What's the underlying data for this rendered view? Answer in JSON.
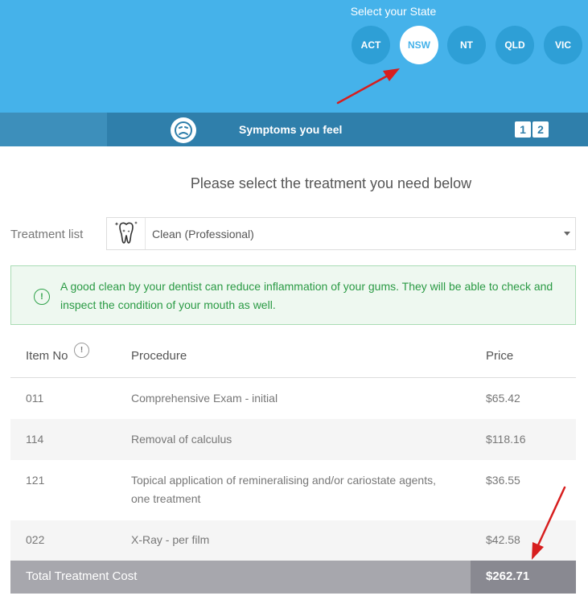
{
  "state_selector": {
    "title": "Select your State",
    "states": [
      "ACT",
      "NSW",
      "NT",
      "QLD",
      "VIC"
    ],
    "selected": "NSW"
  },
  "step": {
    "label": "Symptoms you feel",
    "numbers": [
      "1",
      "2"
    ]
  },
  "heading": "Please select the treatment you need below",
  "treatment_list": {
    "label": "Treatment list",
    "selected_value": "Clean (Professional)"
  },
  "info": {
    "icon": "!",
    "text": "A good clean by your dentist can reduce inflammation of your gums. They will be able to check and inspect the condition of your mouth as well."
  },
  "table": {
    "headers": {
      "item_no": "Item No",
      "procedure": "Procedure",
      "price": "Price",
      "help_icon": "!"
    },
    "rows": [
      {
        "item": "011",
        "procedure": "Comprehensive Exam - initial",
        "price": "$65.42"
      },
      {
        "item": "114",
        "procedure": "Removal of calculus",
        "price": "$118.16"
      },
      {
        "item": "121",
        "procedure": "Topical application of remineralising and/or cariostate agents, one treatment",
        "price": "$36.55"
      },
      {
        "item": "022",
        "procedure": "X-Ray - per film",
        "price": "$42.58"
      }
    ],
    "total_label": "Total Treatment Cost",
    "total_value": "$262.71"
  },
  "colors": {
    "brand_blue": "#45b2ea",
    "step_blue": "#2f7fab",
    "info_green": "#2a9a44",
    "annotation_red": "#d71e1e"
  }
}
